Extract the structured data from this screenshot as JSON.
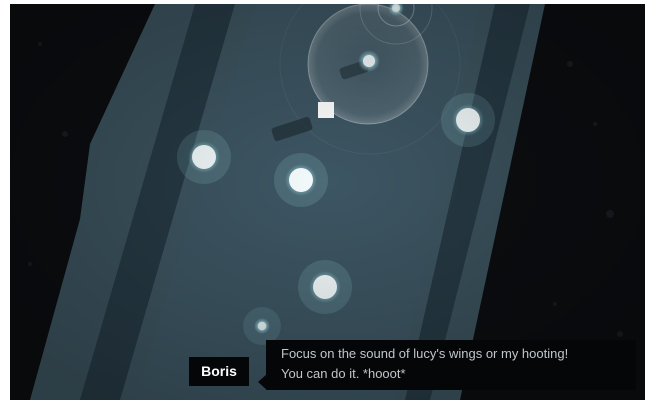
{
  "scene": {
    "colors": {
      "background": "#0b0d10",
      "lane_light": "#3b525d",
      "lane_dark": "#24353f",
      "orb_core": "#f4fbfc",
      "orb_glow": "#9fdde6",
      "player": "#ffffff",
      "dialog_bg": "#050608",
      "dialog_text": "#bfc6cb"
    },
    "icons": {
      "orbs": "glowing-sound-orb",
      "player": "white-square-player",
      "target": "concentric-sonar-rings"
    }
  },
  "dialog": {
    "speaker": "Boris",
    "lines": [
      "Focus on the sound of lucy's wings or my hooting!",
      "You can do it. *hooot*"
    ]
  }
}
